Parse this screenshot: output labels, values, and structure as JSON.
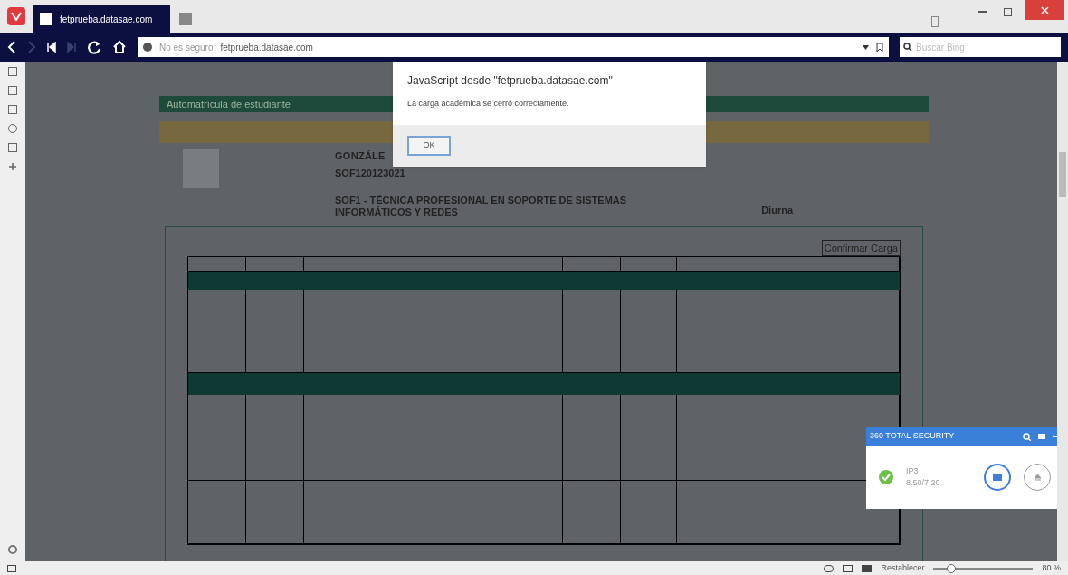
{
  "browser": {
    "tab_title": "fetprueba.datasae.com",
    "address": {
      "security_label": "No es seguro",
      "url": "fetprueba.datasae.com"
    },
    "search": {
      "placeholder": "Buscar Bing"
    }
  },
  "dialog": {
    "title": "JavaScript desde \"fetprueba.datasae.com\"",
    "message": "La carga académica se cerró correctamente.",
    "button": "OK"
  },
  "page": {
    "panel_title": "Automatrícula de estudiante",
    "student": {
      "name": "GONZÁLE",
      "code": "SOF120123021",
      "program": "SOF1 - TÉCNICA PROFESIONAL EN SOPORTE DE SISTEMAS INFORMÁTICOS Y REDES",
      "shift": "Diurna"
    },
    "confirm_button": "Confirmar Carga"
  },
  "security_widget": {
    "title": "360 TOTAL SECURITY",
    "item": "IP3",
    "value": "8.50/7.20"
  },
  "status_bar": {
    "zoom_label": "Restablecer",
    "zoom": {
      "level": 0.15
    },
    "zoom_value": "80 %"
  }
}
